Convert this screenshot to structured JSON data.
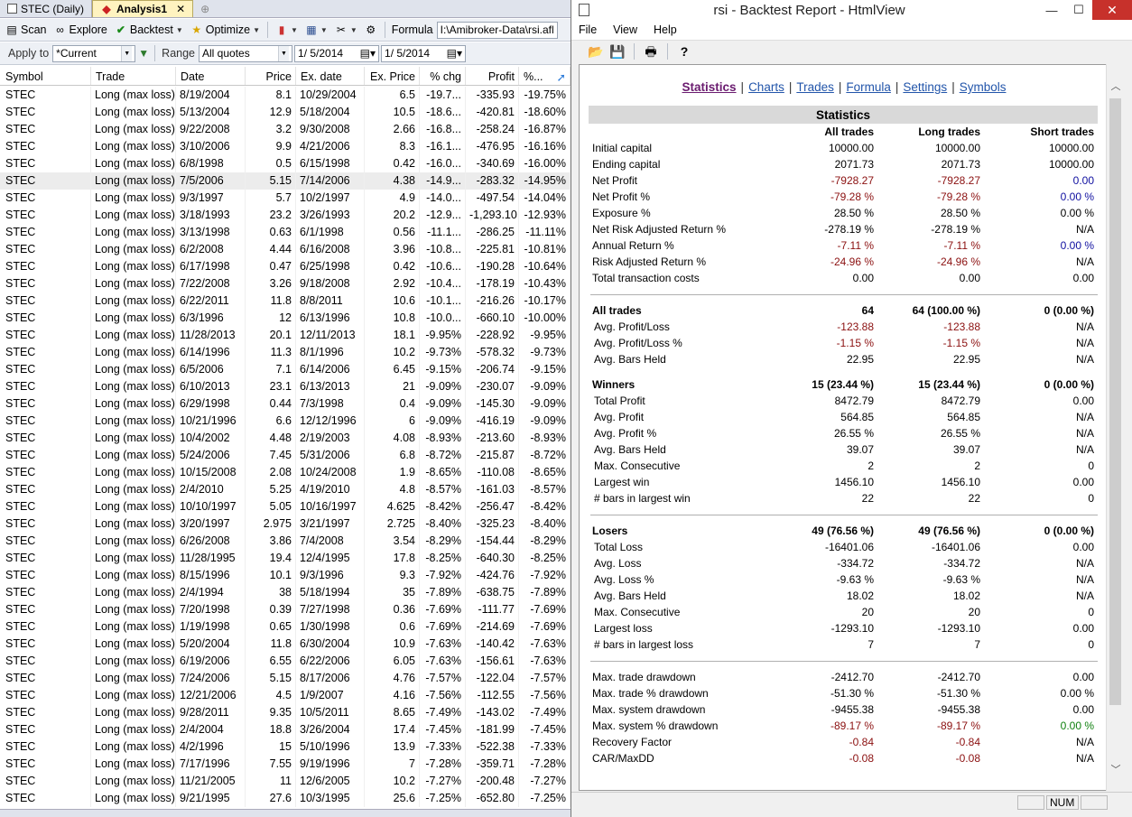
{
  "left": {
    "tabs": [
      {
        "label": "STEC (Daily)",
        "active": false
      },
      {
        "label": "Analysis1",
        "active": true
      }
    ],
    "toolbar1": {
      "scan": "Scan",
      "explore": "Explore",
      "backtest": "Backtest",
      "optimize": "Optimize",
      "formula_label": "Formula",
      "formula_path": "I:\\Amibroker-Data\\rsi.afl"
    },
    "toolbar2": {
      "apply_to_label": "Apply to",
      "apply_to_value": "*Current",
      "range_label": "Range",
      "range_value": "All quotes",
      "date_from": "1/ 5/2014",
      "date_to": "1/ 5/2014"
    },
    "columns": [
      "Symbol",
      "Trade",
      "Date",
      "Price",
      "Ex. date",
      "Ex. Price",
      "% chg",
      "Profit",
      "%..."
    ],
    "rows": [
      [
        "STEC",
        "Long (max loss)",
        "8/19/2004",
        "8.1",
        "10/29/2004",
        "6.5",
        "-19.7...",
        "-335.93",
        "-19.75%"
      ],
      [
        "STEC",
        "Long (max loss)",
        "5/13/2004",
        "12.9",
        "5/18/2004",
        "10.5",
        "-18.6...",
        "-420.81",
        "-18.60%"
      ],
      [
        "STEC",
        "Long (max loss)",
        "9/22/2008",
        "3.2",
        "9/30/2008",
        "2.66",
        "-16.8...",
        "-258.24",
        "-16.87%"
      ],
      [
        "STEC",
        "Long (max loss)",
        "3/10/2006",
        "9.9",
        "4/21/2006",
        "8.3",
        "-16.1...",
        "-476.95",
        "-16.16%"
      ],
      [
        "STEC",
        "Long (max loss)",
        "6/8/1998",
        "0.5",
        "6/15/1998",
        "0.42",
        "-16.0...",
        "-340.69",
        "-16.00%"
      ],
      [
        "STEC",
        "Long (max loss)",
        "7/5/2006",
        "5.15",
        "7/14/2006",
        "4.38",
        "-14.9...",
        "-283.32",
        "-14.95%"
      ],
      [
        "STEC",
        "Long (max loss)",
        "9/3/1997",
        "5.7",
        "10/2/1997",
        "4.9",
        "-14.0...",
        "-497.54",
        "-14.04%"
      ],
      [
        "STEC",
        "Long (max loss)",
        "3/18/1993",
        "23.2",
        "3/26/1993",
        "20.2",
        "-12.9...",
        "-1,293.10",
        "-12.93%"
      ],
      [
        "STEC",
        "Long (max loss)",
        "3/13/1998",
        "0.63",
        "6/1/1998",
        "0.56",
        "-11.1...",
        "-286.25",
        "-11.11%"
      ],
      [
        "STEC",
        "Long (max loss)",
        "6/2/2008",
        "4.44",
        "6/16/2008",
        "3.96",
        "-10.8...",
        "-225.81",
        "-10.81%"
      ],
      [
        "STEC",
        "Long (max loss)",
        "6/17/1998",
        "0.47",
        "6/25/1998",
        "0.42",
        "-10.6...",
        "-190.28",
        "-10.64%"
      ],
      [
        "STEC",
        "Long (max loss)",
        "7/22/2008",
        "3.26",
        "9/18/2008",
        "2.92",
        "-10.4...",
        "-178.19",
        "-10.43%"
      ],
      [
        "STEC",
        "Long (max loss)",
        "6/22/2011",
        "11.8",
        "8/8/2011",
        "10.6",
        "-10.1...",
        "-216.26",
        "-10.17%"
      ],
      [
        "STEC",
        "Long (max loss)",
        "6/3/1996",
        "12",
        "6/13/1996",
        "10.8",
        "-10.0...",
        "-660.10",
        "-10.00%"
      ],
      [
        "STEC",
        "Long (max loss)",
        "11/28/2013",
        "20.1",
        "12/11/2013",
        "18.1",
        "-9.95%",
        "-228.92",
        "-9.95%"
      ],
      [
        "STEC",
        "Long (max loss)",
        "6/14/1996",
        "11.3",
        "8/1/1996",
        "10.2",
        "-9.73%",
        "-578.32",
        "-9.73%"
      ],
      [
        "STEC",
        "Long (max loss)",
        "6/5/2006",
        "7.1",
        "6/14/2006",
        "6.45",
        "-9.15%",
        "-206.74",
        "-9.15%"
      ],
      [
        "STEC",
        "Long (max loss)",
        "6/10/2013",
        "23.1",
        "6/13/2013",
        "21",
        "-9.09%",
        "-230.07",
        "-9.09%"
      ],
      [
        "STEC",
        "Long (max loss)",
        "6/29/1998",
        "0.44",
        "7/3/1998",
        "0.4",
        "-9.09%",
        "-145.30",
        "-9.09%"
      ],
      [
        "STEC",
        "Long (max loss)",
        "10/21/1996",
        "6.6",
        "12/12/1996",
        "6",
        "-9.09%",
        "-416.19",
        "-9.09%"
      ],
      [
        "STEC",
        "Long (max loss)",
        "10/4/2002",
        "4.48",
        "2/19/2003",
        "4.08",
        "-8.93%",
        "-213.60",
        "-8.93%"
      ],
      [
        "STEC",
        "Long (max loss)",
        "5/24/2006",
        "7.45",
        "5/31/2006",
        "6.8",
        "-8.72%",
        "-215.87",
        "-8.72%"
      ],
      [
        "STEC",
        "Long (max loss)",
        "10/15/2008",
        "2.08",
        "10/24/2008",
        "1.9",
        "-8.65%",
        "-110.08",
        "-8.65%"
      ],
      [
        "STEC",
        "Long (max loss)",
        "2/4/2010",
        "5.25",
        "4/19/2010",
        "4.8",
        "-8.57%",
        "-161.03",
        "-8.57%"
      ],
      [
        "STEC",
        "Long (max loss)",
        "10/10/1997",
        "5.05",
        "10/16/1997",
        "4.625",
        "-8.42%",
        "-256.47",
        "-8.42%"
      ],
      [
        "STEC",
        "Long (max loss)",
        "3/20/1997",
        "2.975",
        "3/21/1997",
        "2.725",
        "-8.40%",
        "-325.23",
        "-8.40%"
      ],
      [
        "STEC",
        "Long (max loss)",
        "6/26/2008",
        "3.86",
        "7/4/2008",
        "3.54",
        "-8.29%",
        "-154.44",
        "-8.29%"
      ],
      [
        "STEC",
        "Long (max loss)",
        "11/28/1995",
        "19.4",
        "12/4/1995",
        "17.8",
        "-8.25%",
        "-640.30",
        "-8.25%"
      ],
      [
        "STEC",
        "Long (max loss)",
        "8/15/1996",
        "10.1",
        "9/3/1996",
        "9.3",
        "-7.92%",
        "-424.76",
        "-7.92%"
      ],
      [
        "STEC",
        "Long (max loss)",
        "2/4/1994",
        "38",
        "5/18/1994",
        "35",
        "-7.89%",
        "-638.75",
        "-7.89%"
      ],
      [
        "STEC",
        "Long (max loss)",
        "7/20/1998",
        "0.39",
        "7/27/1998",
        "0.36",
        "-7.69%",
        "-111.77",
        "-7.69%"
      ],
      [
        "STEC",
        "Long (max loss)",
        "1/19/1998",
        "0.65",
        "1/30/1998",
        "0.6",
        "-7.69%",
        "-214.69",
        "-7.69%"
      ],
      [
        "STEC",
        "Long (max loss)",
        "5/20/2004",
        "11.8",
        "6/30/2004",
        "10.9",
        "-7.63%",
        "-140.42",
        "-7.63%"
      ],
      [
        "STEC",
        "Long (max loss)",
        "6/19/2006",
        "6.55",
        "6/22/2006",
        "6.05",
        "-7.63%",
        "-156.61",
        "-7.63%"
      ],
      [
        "STEC",
        "Long (max loss)",
        "7/24/2006",
        "5.15",
        "8/17/2006",
        "4.76",
        "-7.57%",
        "-122.04",
        "-7.57%"
      ],
      [
        "STEC",
        "Long (max loss)",
        "12/21/2006",
        "4.5",
        "1/9/2007",
        "4.16",
        "-7.56%",
        "-112.55",
        "-7.56%"
      ],
      [
        "STEC",
        "Long (max loss)",
        "9/28/2011",
        "9.35",
        "10/5/2011",
        "8.65",
        "-7.49%",
        "-143.02",
        "-7.49%"
      ],
      [
        "STEC",
        "Long (max loss)",
        "2/4/2004",
        "18.8",
        "3/26/2004",
        "17.4",
        "-7.45%",
        "-181.99",
        "-7.45%"
      ],
      [
        "STEC",
        "Long (max loss)",
        "4/2/1996",
        "15",
        "5/10/1996",
        "13.9",
        "-7.33%",
        "-522.38",
        "-7.33%"
      ],
      [
        "STEC",
        "Long (max loss)",
        "7/17/1996",
        "7.55",
        "9/19/1996",
        "7",
        "-7.28%",
        "-359.71",
        "-7.28%"
      ],
      [
        "STEC",
        "Long (max loss)",
        "11/21/2005",
        "11",
        "12/6/2005",
        "10.2",
        "-7.27%",
        "-200.48",
        "-7.27%"
      ],
      [
        "STEC",
        "Long (max loss)",
        "9/21/1995",
        "27.6",
        "10/3/1995",
        "25.6",
        "-7.25%",
        "-652.80",
        "-7.25%"
      ]
    ],
    "selected_row": 5
  },
  "right": {
    "window_title": "rsi - Backtest Report - HtmlView",
    "menu": [
      "File",
      "View",
      "Help"
    ],
    "nav_links": [
      {
        "label": "Statistics",
        "active": true
      },
      {
        "label": "Charts",
        "active": false
      },
      {
        "label": "Trades",
        "active": false
      },
      {
        "label": "Formula",
        "active": false
      },
      {
        "label": "Settings",
        "active": false
      },
      {
        "label": "Symbols",
        "active": false
      }
    ],
    "stats_title": "Statistics",
    "col_headers": [
      "",
      "All trades",
      "Long trades",
      "Short trades"
    ],
    "stats_rows": [
      {
        "kind": "row",
        "label": "Initial capital",
        "all": "10000.00",
        "long": "10000.00",
        "short": "10000.00"
      },
      {
        "kind": "row",
        "label": "Ending capital",
        "all": "2071.73",
        "long": "2071.73",
        "short": "10000.00"
      },
      {
        "kind": "row",
        "label": "Net Profit",
        "all": "-7928.27",
        "long": "-7928.27",
        "short": "0.00",
        "cls": [
          "neg",
          "neg",
          "blu"
        ]
      },
      {
        "kind": "row",
        "label": "Net Profit %",
        "all": "-79.28 %",
        "long": "-79.28 %",
        "short": "0.00 %",
        "cls": [
          "neg",
          "neg",
          "blu"
        ]
      },
      {
        "kind": "row",
        "label": "Exposure %",
        "all": "28.50 %",
        "long": "28.50 %",
        "short": "0.00 %"
      },
      {
        "kind": "row",
        "label": "Net Risk Adjusted Return %",
        "all": "-278.19 %",
        "long": "-278.19 %",
        "short": "N/A"
      },
      {
        "kind": "row",
        "label": "Annual Return %",
        "all": "-7.11 %",
        "long": "-7.11 %",
        "short": "0.00 %",
        "cls": [
          "neg",
          "neg",
          "blu"
        ]
      },
      {
        "kind": "row",
        "label": "Risk Adjusted Return %",
        "all": "-24.96 %",
        "long": "-24.96 %",
        "short": "N/A",
        "cls": [
          "neg",
          "neg",
          ""
        ]
      },
      {
        "kind": "row",
        "label": "Total transaction costs",
        "all": "0.00",
        "long": "0.00",
        "short": "0.00"
      },
      {
        "kind": "rule"
      },
      {
        "kind": "sec",
        "label": "All trades",
        "all": "64",
        "long": "64 (100.00 %)",
        "short": "0 (0.00 %)"
      },
      {
        "kind": "row",
        "ind": true,
        "label": "Avg. Profit/Loss",
        "all": "-123.88",
        "long": "-123.88",
        "short": "N/A",
        "cls": [
          "neg",
          "neg",
          ""
        ]
      },
      {
        "kind": "row",
        "ind": true,
        "label": "Avg. Profit/Loss %",
        "all": "-1.15 %",
        "long": "-1.15 %",
        "short": "N/A",
        "cls": [
          "neg",
          "neg",
          ""
        ]
      },
      {
        "kind": "row",
        "ind": true,
        "label": "Avg. Bars Held",
        "all": "22.95",
        "long": "22.95",
        "short": "N/A"
      },
      {
        "kind": "gap"
      },
      {
        "kind": "sec",
        "label": "Winners",
        "all": "15 (23.44 %)",
        "long": "15 (23.44 %)",
        "short": "0 (0.00 %)"
      },
      {
        "kind": "row",
        "ind": true,
        "label": "Total Profit",
        "all": "8472.79",
        "long": "8472.79",
        "short": "0.00"
      },
      {
        "kind": "row",
        "ind": true,
        "label": "Avg. Profit",
        "all": "564.85",
        "long": "564.85",
        "short": "N/A"
      },
      {
        "kind": "row",
        "ind": true,
        "label": "Avg. Profit %",
        "all": "26.55 %",
        "long": "26.55 %",
        "short": "N/A"
      },
      {
        "kind": "row",
        "ind": true,
        "label": "Avg. Bars Held",
        "all": "39.07",
        "long": "39.07",
        "short": "N/A"
      },
      {
        "kind": "row",
        "ind": true,
        "label": "Max. Consecutive",
        "all": "2",
        "long": "2",
        "short": "0"
      },
      {
        "kind": "row",
        "ind": true,
        "label": "Largest win",
        "all": "1456.10",
        "long": "1456.10",
        "short": "0.00"
      },
      {
        "kind": "row",
        "ind": true,
        "label": "# bars in largest win",
        "all": "22",
        "long": "22",
        "short": "0"
      },
      {
        "kind": "rule"
      },
      {
        "kind": "sec",
        "label": "Losers",
        "all": "49 (76.56 %)",
        "long": "49 (76.56 %)",
        "short": "0 (0.00 %)"
      },
      {
        "kind": "row",
        "ind": true,
        "label": "Total Loss",
        "all": "-16401.06",
        "long": "-16401.06",
        "short": "0.00"
      },
      {
        "kind": "row",
        "ind": true,
        "label": "Avg. Loss",
        "all": "-334.72",
        "long": "-334.72",
        "short": "N/A"
      },
      {
        "kind": "row",
        "ind": true,
        "label": "Avg. Loss %",
        "all": "-9.63 %",
        "long": "-9.63 %",
        "short": "N/A"
      },
      {
        "kind": "row",
        "ind": true,
        "label": "Avg. Bars Held",
        "all": "18.02",
        "long": "18.02",
        "short": "N/A"
      },
      {
        "kind": "row",
        "ind": true,
        "label": "Max. Consecutive",
        "all": "20",
        "long": "20",
        "short": "0"
      },
      {
        "kind": "row",
        "ind": true,
        "label": "Largest loss",
        "all": "-1293.10",
        "long": "-1293.10",
        "short": "0.00"
      },
      {
        "kind": "row",
        "ind": true,
        "label": "# bars in largest loss",
        "all": "7",
        "long": "7",
        "short": "0"
      },
      {
        "kind": "rule"
      },
      {
        "kind": "row",
        "label": "Max. trade drawdown",
        "all": "-2412.70",
        "long": "-2412.70",
        "short": "0.00"
      },
      {
        "kind": "row",
        "label": "Max. trade % drawdown",
        "all": "-51.30 %",
        "long": "-51.30 %",
        "short": "0.00 %"
      },
      {
        "kind": "row",
        "label": "Max. system drawdown",
        "all": "-9455.38",
        "long": "-9455.38",
        "short": "0.00"
      },
      {
        "kind": "row",
        "label": "Max. system % drawdown",
        "all": "-89.17 %",
        "long": "-89.17 %",
        "short": "0.00 %",
        "cls": [
          "neg",
          "neg",
          "grn"
        ]
      },
      {
        "kind": "row",
        "label": "Recovery Factor",
        "all": "-0.84",
        "long": "-0.84",
        "short": "N/A",
        "cls": [
          "neg",
          "neg",
          ""
        ]
      },
      {
        "kind": "row",
        "label": "CAR/MaxDD",
        "all": "-0.08",
        "long": "-0.08",
        "short": "N/A",
        "cls": [
          "neg",
          "neg",
          ""
        ]
      }
    ],
    "status_num": "NUM"
  }
}
